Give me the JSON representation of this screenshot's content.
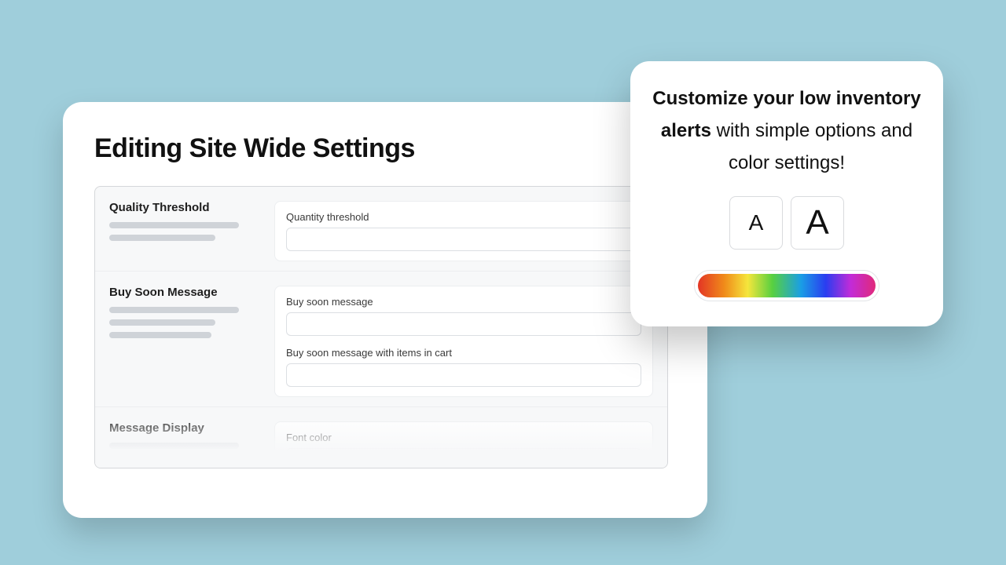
{
  "settings": {
    "title": "Editing Site Wide Settings",
    "sections": [
      {
        "label": "Quality Threshold",
        "fields": [
          {
            "label": "Quantity threshold",
            "value": ""
          }
        ]
      },
      {
        "label": "Buy Soon Message",
        "fields": [
          {
            "label": "Buy soon message",
            "value": ""
          },
          {
            "label": "Buy soon message with items in cart",
            "value": ""
          }
        ]
      },
      {
        "label": "Message Display",
        "fields": [
          {
            "label": "Font color",
            "value": ""
          }
        ]
      }
    ]
  },
  "popover": {
    "text_bold": "Customize your low inventory alerts",
    "text_rest": " with simple options and color settings!",
    "size_small": "A",
    "size_large": "A"
  }
}
